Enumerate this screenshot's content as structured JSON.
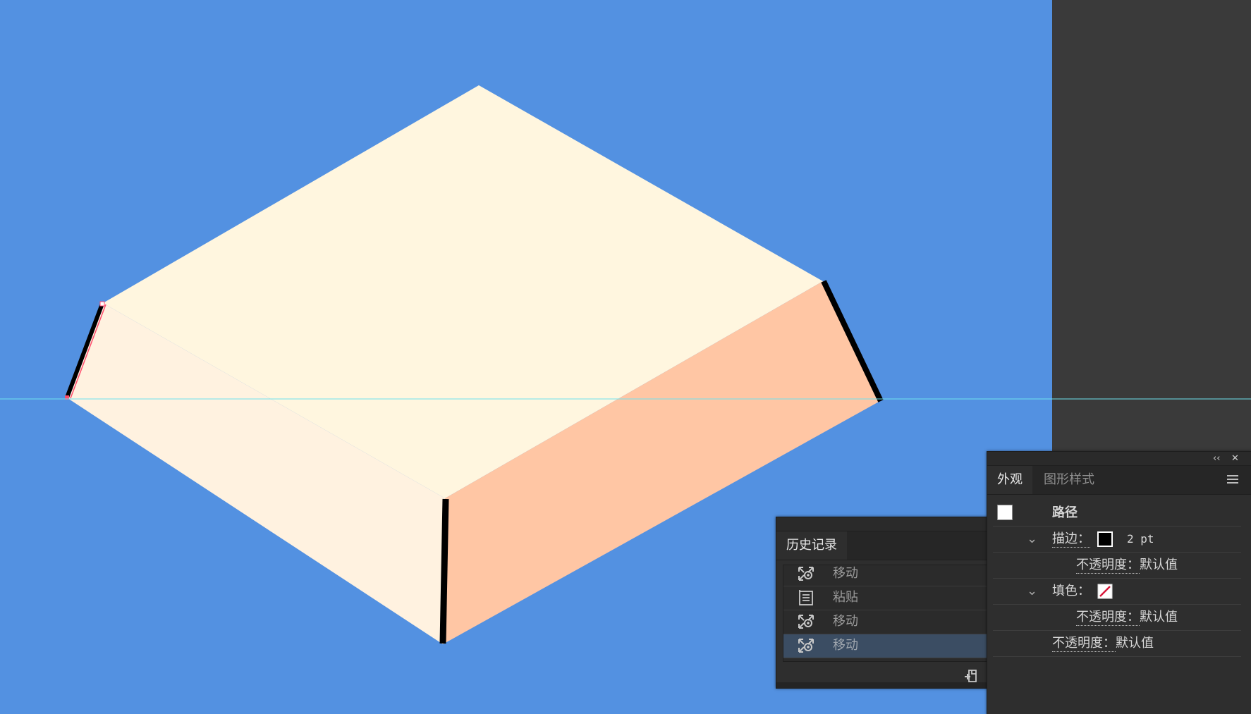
{
  "colors": {
    "artboard_bg": "#5391e1",
    "box_top": "#fff6df",
    "box_left": "#fff2e0",
    "box_right": "#ffc6a4",
    "edge": "#000000",
    "guide": "#6fe3ee",
    "pasteboard": "#3a3a3a",
    "selection_row": "#3b4d63"
  },
  "history_panel": {
    "collapse_glyph": "‹‹",
    "close_glyph": "✕",
    "tab_label": "历史记录",
    "items": [
      {
        "label": "移动",
        "icon": "move-icon"
      },
      {
        "label": "粘贴",
        "icon": "paste-icon"
      },
      {
        "label": "移动",
        "icon": "move-icon"
      },
      {
        "label": "移动",
        "icon": "move-icon",
        "selected": true
      }
    ],
    "footer": {
      "new_document_icon": "new-document-from-state-icon",
      "delete_icon": "trash-icon"
    }
  },
  "appearance_panel": {
    "collapse_glyph": "‹‹",
    "close_glyph": "✕",
    "tabs": [
      "外观",
      "图形样式"
    ],
    "object_label": "路径",
    "stroke_label": "描边：",
    "stroke_value": "2 pt",
    "stroke_opacity_label": "不透明度：",
    "stroke_opacity_value": "默认值",
    "fill_label": "填色：",
    "fill_opacity_label": "不透明度：",
    "fill_opacity_value": "默认值",
    "opacity_label": "不透明度：",
    "opacity_value": "默认值"
  }
}
